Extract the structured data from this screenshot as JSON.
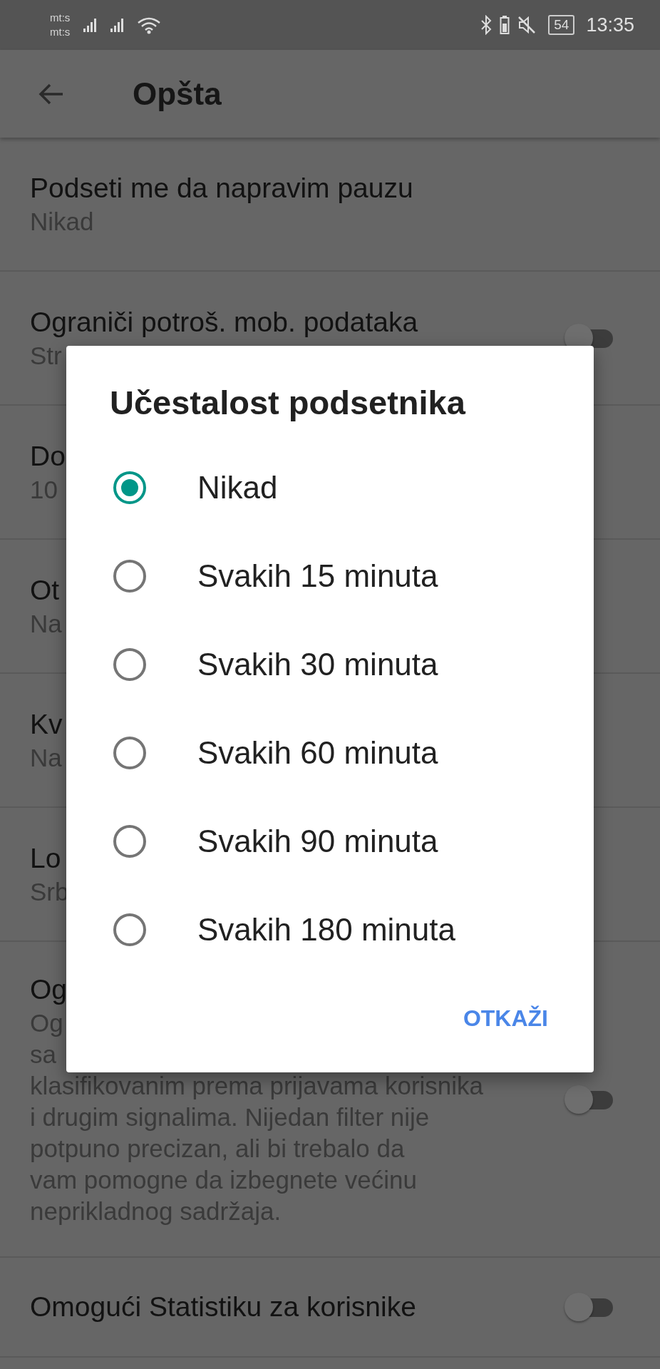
{
  "status_bar": {
    "carriers": [
      "mt:s",
      "mt:s"
    ],
    "battery_level_text": "54",
    "time": "13:35"
  },
  "app_bar": {
    "title": "Opšta"
  },
  "settings": [
    {
      "kind": "plain",
      "title": "Podseti me da napravim pauzu",
      "subtitle_lines": [
        "Nikad"
      ]
    },
    {
      "kind": "toggle",
      "title": "Ograniči potroš. mob. podataka",
      "subtitle_lines": [
        "Str"
      ],
      "on": false
    },
    {
      "kind": "plain",
      "title": "Do",
      "subtitle_lines": [
        "10"
      ]
    },
    {
      "kind": "plain",
      "title": "Ot",
      "subtitle_lines": [
        "Na"
      ]
    },
    {
      "kind": "plain",
      "title": "Kv",
      "subtitle_lines": [
        "Na"
      ]
    },
    {
      "kind": "plain",
      "title": "Lo",
      "subtitle_lines": [
        "Srb"
      ]
    },
    {
      "kind": "toggle",
      "title": "Og",
      "subtitle_lines": [
        "Og",
        "sa",
        "klasifikovanim prema prijavama korisnika",
        "i drugim signalima. Nijedan filter nije",
        "potpuno precizan, ali bi trebalo da",
        "vam pomogne da izbegnete većinu",
        "neprikladnog sadržaja."
      ],
      "on": false
    },
    {
      "kind": "toggle",
      "title": "Omogući Statistiku za korisnike",
      "on": false
    }
  ],
  "dialog": {
    "title": "Učestalost podsetnika",
    "options": [
      {
        "label": "Nikad",
        "selected": true
      },
      {
        "label": "Svakih 15 minuta",
        "selected": false
      },
      {
        "label": "Svakih 30 minuta",
        "selected": false
      },
      {
        "label": "Svakih 60 minuta",
        "selected": false
      },
      {
        "label": "Svakih 90 minuta",
        "selected": false
      },
      {
        "label": "Svakih 180 minuta",
        "selected": false
      }
    ],
    "buttons": [
      "OTKAŽI"
    ]
  }
}
